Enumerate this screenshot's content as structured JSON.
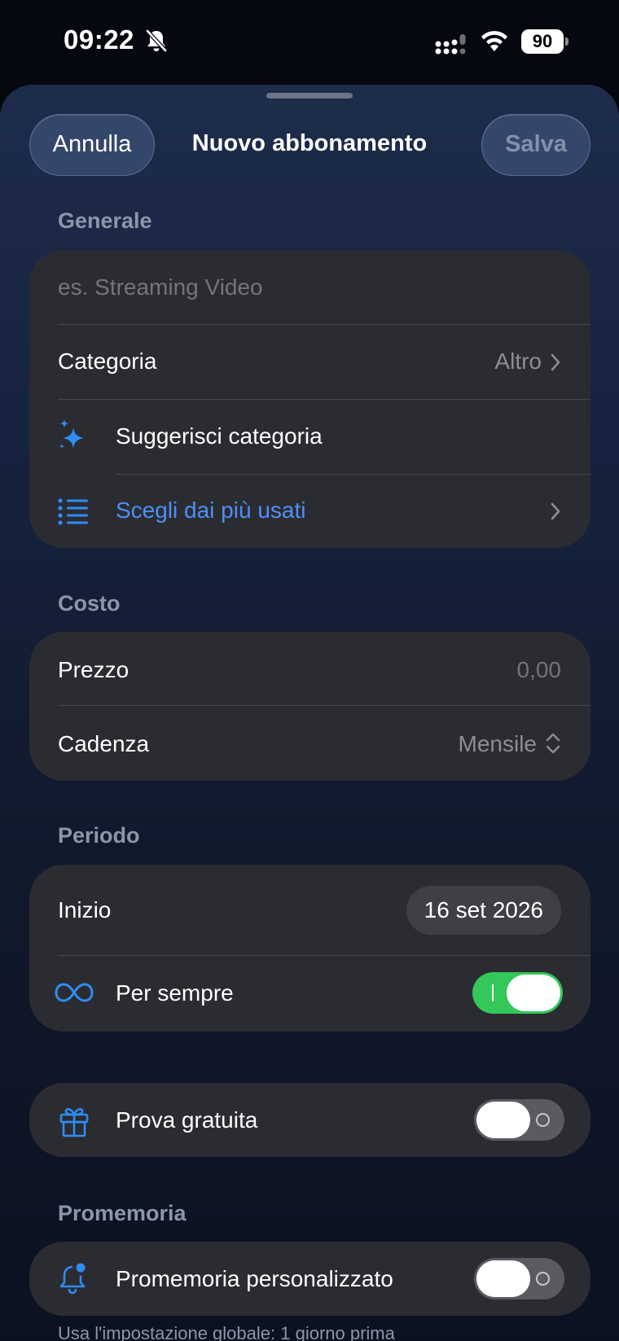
{
  "status_bar": {
    "time": "09:22",
    "battery": "90"
  },
  "header": {
    "cancel": "Annulla",
    "title": "Nuovo abbonamento",
    "save": "Salva"
  },
  "general": {
    "section_title": "Generale",
    "name_placeholder": "es. Streaming Video",
    "category_label": "Categoria",
    "category_value": "Altro",
    "suggest_label": "Suggerisci categoria",
    "popular_label": "Scegli dai più usati"
  },
  "cost": {
    "section_title": "Costo",
    "price_label": "Prezzo",
    "price_placeholder": "0,00",
    "cadence_label": "Cadenza",
    "cadence_value": "Mensile"
  },
  "period": {
    "section_title": "Periodo",
    "start_label": "Inizio",
    "start_value": "16 set 2026",
    "forever_label": "Per sempre",
    "forever_on": true
  },
  "trial": {
    "label": "Prova gratuita",
    "on": false
  },
  "reminder": {
    "section_title": "Promemoria",
    "custom_label": "Promemoria personalizzato",
    "custom_on": false,
    "footnote": "Usa l'impostazione globale: 1 giorno prima"
  },
  "colors": {
    "accent": "#4f8ef7",
    "icon_blue": "#2f8cf5",
    "toggle_on": "#34c759",
    "card": "#2b2c31"
  },
  "icons": [
    "bell-off-icon",
    "signal-icon",
    "wifi-icon",
    "sparkles-icon",
    "list-icon",
    "chevron-right-icon",
    "chevron-up-down-icon",
    "infinity-icon",
    "gift-icon",
    "bell-badge-icon"
  ]
}
